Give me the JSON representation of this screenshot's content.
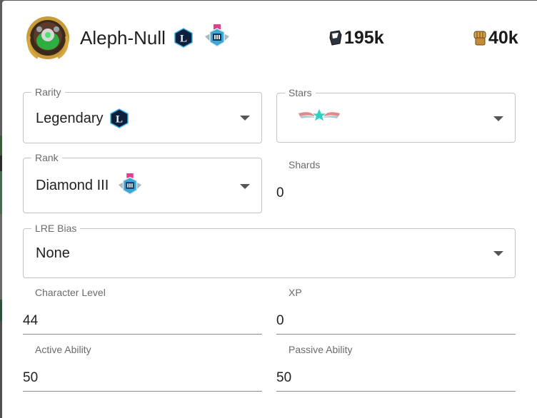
{
  "character": {
    "name": "Aleph-Null",
    "power": "195k",
    "bs": "40k"
  },
  "form": {
    "rarity": {
      "label": "Rarity",
      "value": "Legendary",
      "badge_letter": "L"
    },
    "stars": {
      "label": "Stars"
    },
    "rank": {
      "label": "Rank",
      "value": "Diamond III"
    },
    "shards": {
      "label": "Shards",
      "value": "0"
    },
    "lre_bias": {
      "label": "LRE Bias",
      "value": "None"
    },
    "character_level": {
      "label": "Character Level",
      "value": "44"
    },
    "xp": {
      "label": "XP",
      "value": "0"
    },
    "active_ability": {
      "label": "Active Ability",
      "value": "50"
    },
    "passive_ability": {
      "label": "Passive Ability",
      "value": "50"
    }
  },
  "colors": {
    "legendary_badge": "#1b3e6b",
    "rank_ribbon": "#e0408a",
    "text": "#1f1f1f",
    "label": "#6b6b6b",
    "border": "#c4c4c4"
  },
  "icons": {
    "power": "power-fist-icon",
    "bs": "fist-icon",
    "dropdown": "chevron-down-icon"
  }
}
